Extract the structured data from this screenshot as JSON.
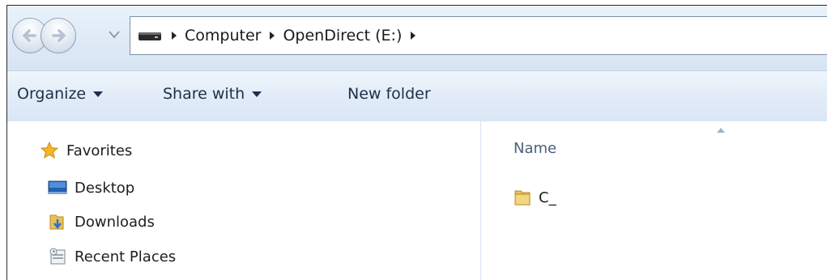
{
  "address_bar": {
    "breadcrumbs": [
      "Computer",
      "OpenDirect (E:)"
    ],
    "icons": {
      "back": "back-arrow-icon",
      "forward": "forward-arrow-icon",
      "recent": "recent-pages-dropdown-icon",
      "drive": "drive-icon"
    }
  },
  "command_bar": {
    "organize_label": "Organize",
    "share_label": "Share with",
    "new_folder_label": "New folder"
  },
  "nav_pane": {
    "favorites_label": "Favorites",
    "items": [
      {
        "label": "Desktop",
        "icon": "desktop-icon"
      },
      {
        "label": "Downloads",
        "icon": "downloads-folder-icon"
      },
      {
        "label": "Recent Places",
        "icon": "recent-places-icon"
      }
    ]
  },
  "content": {
    "column_header": "Name",
    "sort": "ascending",
    "files": [
      {
        "name": "C_",
        "icon": "folder-icon"
      }
    ]
  },
  "colors": {
    "accent": "#3f7cc0",
    "folder": "#e8c15a",
    "window_frame": "#dfeaf6"
  }
}
